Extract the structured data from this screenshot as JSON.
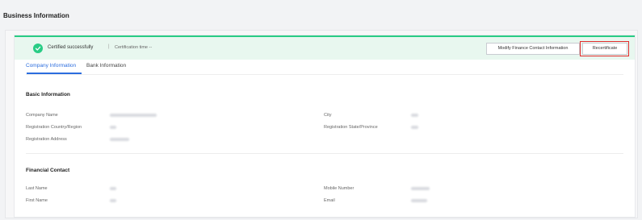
{
  "page": {
    "title": "Business Information"
  },
  "banner": {
    "status": "Certified successfully",
    "separator": "|",
    "cert_time": "Certification time --",
    "modify_button": "Modify Finance Contact Information",
    "recertificate_button": "Recertificate",
    "success_color": "#29cc85"
  },
  "tabs": [
    {
      "label": "Company Information",
      "active": true
    },
    {
      "label": "Bank Information",
      "active": false
    }
  ],
  "basic": {
    "title": "Basic Information",
    "labels": {
      "company_name": "Company Name",
      "registration_country": "Registration Country/Region",
      "registration_address": "Registration Address",
      "city": "City",
      "registration_state": "Registration State/Province"
    }
  },
  "contact": {
    "title": "Financial Contact",
    "labels": {
      "last_name": "Last Name",
      "first_name": "First Name",
      "mobile_number": "Mobile Number",
      "email": "Email"
    }
  },
  "accent_color": "#2b6dde"
}
